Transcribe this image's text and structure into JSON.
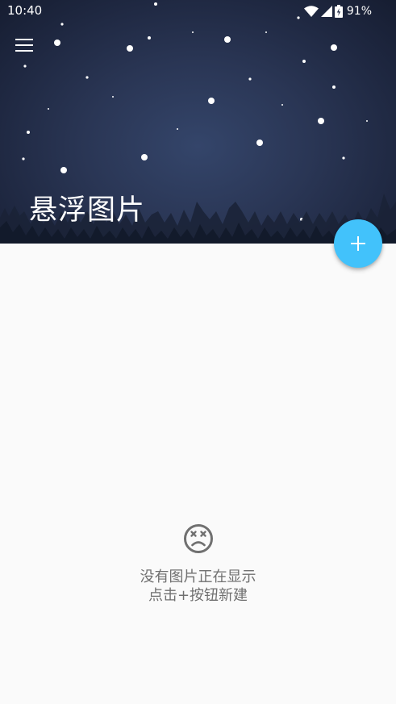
{
  "status_bar": {
    "time": "10:40",
    "battery": "91%",
    "icons": [
      "wifi-icon",
      "cellular-signal-icon",
      "battery-charging-icon"
    ]
  },
  "header": {
    "title": "悬浮图片",
    "menu_icon": "hamburger-menu-icon"
  },
  "fab": {
    "icon": "plus-icon",
    "color": "#42c2fb"
  },
  "empty_state": {
    "icon": "sad-face-icon",
    "line1": "没有图片正在显示",
    "line2": "点击+按钮新建"
  },
  "colors": {
    "header_dark": "#1e2740",
    "background": "#fafafa",
    "text_secondary": "#707070",
    "accent": "#42c2fb"
  }
}
